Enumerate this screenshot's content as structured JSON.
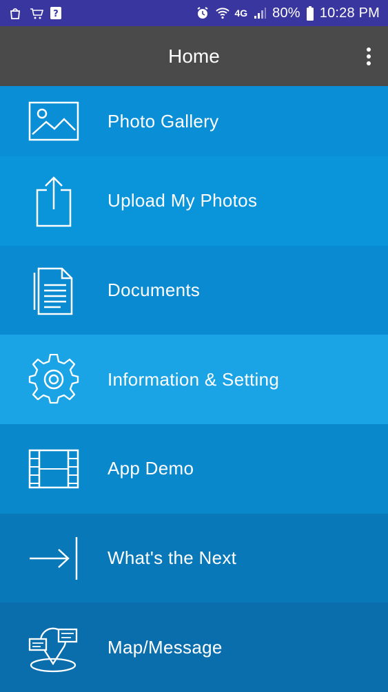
{
  "status_bar": {
    "battery": "80%",
    "time": "10:28 PM",
    "network": "4G",
    "icons": [
      "shopping-bag-icon",
      "amazon-cart-icon",
      "help-icon",
      "alarm-icon",
      "wifi-icon",
      "signal-icon",
      "battery-icon"
    ]
  },
  "app_bar": {
    "title": "Home",
    "overflow_icon": "more-vert-icon"
  },
  "menu": {
    "items": [
      {
        "label": "Photo Gallery",
        "icon": "image-icon"
      },
      {
        "label": "Upload My Photos",
        "icon": "upload-icon"
      },
      {
        "label": "Documents",
        "icon": "documents-icon"
      },
      {
        "label": "Information & Setting",
        "icon": "gear-icon"
      },
      {
        "label": "App Demo",
        "icon": "film-icon"
      },
      {
        "label": "What's the Next",
        "icon": "arrow-right-icon"
      },
      {
        "label": "Map/Message",
        "icon": "map-message-icon"
      }
    ]
  },
  "colors": {
    "status_bar": "#3a36a0",
    "app_bar": "#4a4a4a",
    "item_highlight": "#1aa4e6"
  }
}
